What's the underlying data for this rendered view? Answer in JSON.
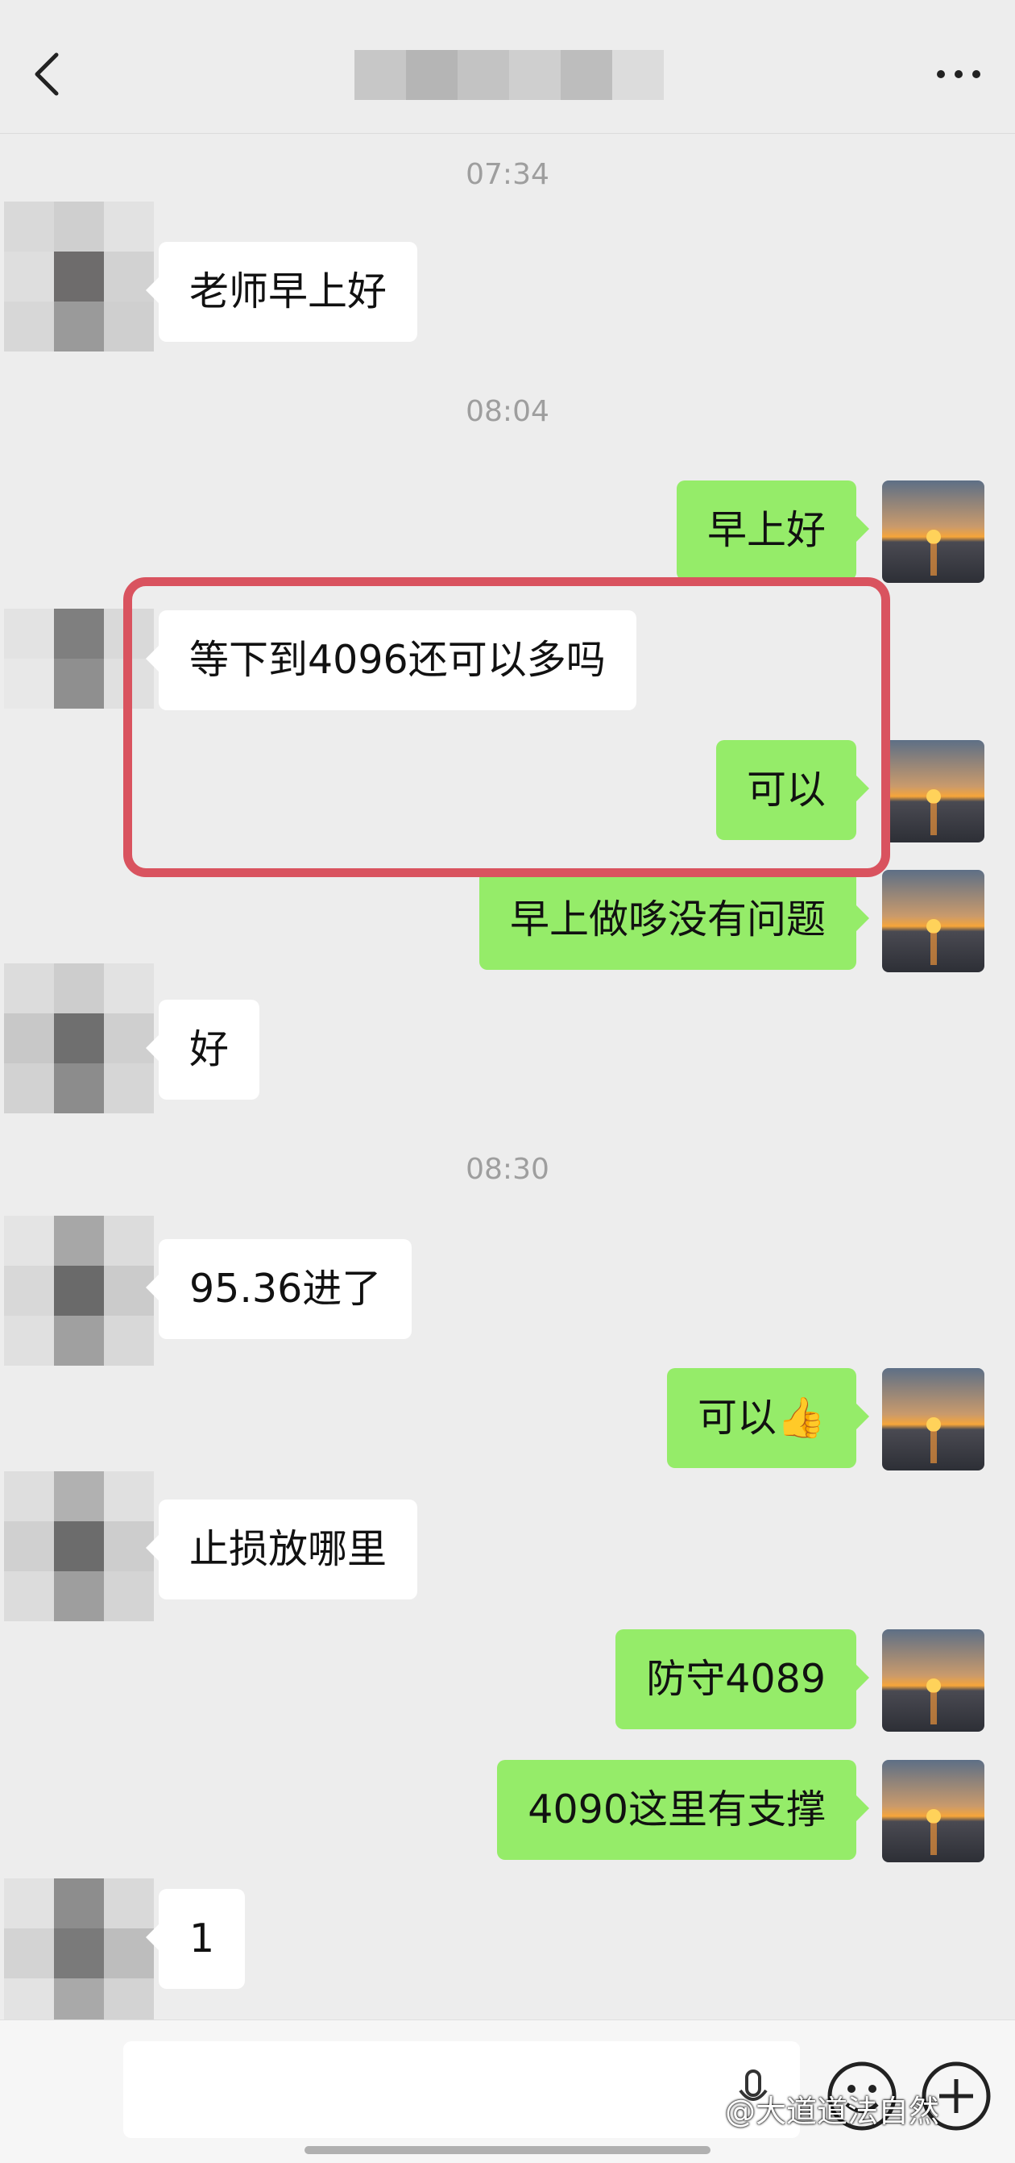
{
  "header": {
    "back_icon": "chevron-left-icon",
    "more_icon": "ellipsis-icon"
  },
  "times": [
    "07:34",
    "08:04",
    "08:30"
  ],
  "messages": [
    {
      "side": "left",
      "text": "老师早上好"
    },
    {
      "side": "right",
      "text": "早上好"
    },
    {
      "side": "left",
      "text": "等下到4096还可以多吗"
    },
    {
      "side": "right",
      "text": "可以"
    },
    {
      "side": "right",
      "text": "早上做哆没有问题"
    },
    {
      "side": "left",
      "text": "好"
    },
    {
      "side": "left",
      "text": "95.36进了"
    },
    {
      "side": "right",
      "text": "可以"
    },
    {
      "side": "left",
      "text": "止损放哪里"
    },
    {
      "side": "right",
      "text": "防守4089"
    },
    {
      "side": "right",
      "text": "4090这里有支撑"
    },
    {
      "side": "left",
      "text": "1"
    }
  ],
  "emoji": "👍",
  "highlight_color": "#d9535f",
  "bubble_colors": {
    "self": "#95ec69",
    "other": "#ffffff"
  },
  "bottom": {
    "voice_icon": "microphone-icon",
    "emoji_icon": "smiley-icon",
    "plus_icon": "plus-circle-icon"
  },
  "watermark": "@大道道法自然"
}
